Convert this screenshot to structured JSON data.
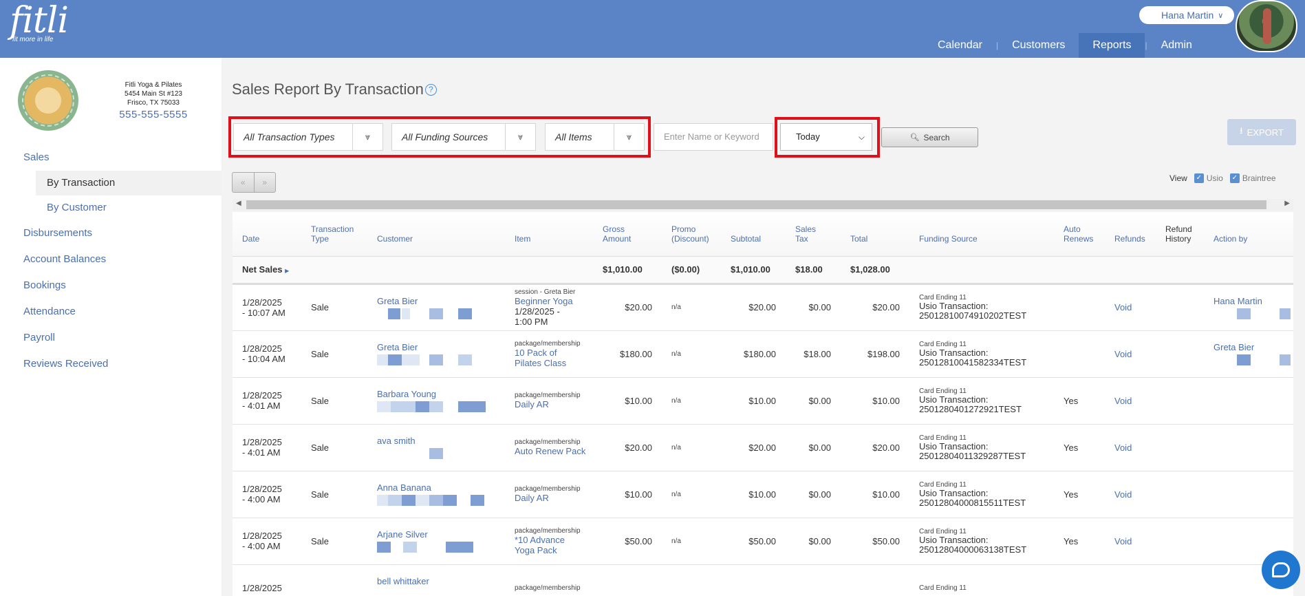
{
  "brand": {
    "name": "fitli",
    "tagline": "fit more in life"
  },
  "user": {
    "name": "Hana Martin"
  },
  "nav": [
    "Calendar",
    "Customers",
    "Reports",
    "Admin"
  ],
  "studio": {
    "name": "Fitli Yoga & Pilates",
    "address1": "5454 Main St #123",
    "address2": "Frisco, TX 75033",
    "phone": "555-555-5555"
  },
  "sidebar": {
    "sales": "Sales",
    "sub": [
      "By Transaction",
      "By Customer"
    ],
    "items": [
      "Disbursements",
      "Account Balances",
      "Bookings",
      "Attendance",
      "Payroll",
      "Reviews Received"
    ]
  },
  "page": {
    "title": "Sales Report By Transaction",
    "help": "?"
  },
  "filters": {
    "transaction_types": "All Transaction Types",
    "funding_sources": "All Funding Sources",
    "items": "All Items",
    "keyword_placeholder": "Enter Name or Keyword",
    "date": "Today",
    "search": "Search",
    "export": "EXPORT"
  },
  "pager": {
    "prev": "«",
    "next": "»"
  },
  "view": {
    "label": "View",
    "opt1": "Usio",
    "opt2": "Braintree"
  },
  "columns": {
    "date": "Date",
    "type1": "Transaction",
    "type2": "Type",
    "customer": "Customer",
    "item": "Item",
    "gross1": "Gross",
    "gross2": "Amount",
    "promo1": "Promo",
    "promo2": "(Discount)",
    "subtotal": "Subtotal",
    "tax1": "Sales",
    "tax2": "Tax",
    "total": "Total",
    "funding": "Funding Source",
    "auto1": "Auto",
    "auto2": "Renews",
    "refunds": "Refunds",
    "rh1": "Refund",
    "rh2": "History",
    "action": "Action by"
  },
  "net_sales": {
    "label": "Net Sales",
    "gross": "$1,010.00",
    "promo": "($0.00)",
    "subtotal": "$1,010.00",
    "tax": "$18.00",
    "total": "$1,028.00"
  },
  "rows": [
    {
      "date1": "1/28/2025",
      "date2": "- 10:07 AM",
      "type": "Sale",
      "customer": "Greta Bier",
      "item_cat": "session - Greta Bier",
      "item1": "Beginner Yoga",
      "item2": "1/28/2025 -",
      "item3": "1:00 PM",
      "gross": "$20.00",
      "promo": "n/a",
      "subtotal": "$20.00",
      "tax": "$0.00",
      "total": "$20.00",
      "card": "Card Ending 11",
      "usio": "Usio Transaction:",
      "txn": "25012810074910202TEST",
      "auto": "",
      "refund": "Void",
      "action": "Hana Martin"
    },
    {
      "date1": "1/28/2025",
      "date2": "- 10:04 AM",
      "type": "Sale",
      "customer": "Greta Bier",
      "item_cat": "package/membership",
      "item1": "10 Pack of",
      "item2": "Pilates Class",
      "item3": "",
      "gross": "$180.00",
      "promo": "n/a",
      "subtotal": "$180.00",
      "tax": "$18.00",
      "total": "$198.00",
      "card": "Card Ending 11",
      "usio": "Usio Transaction:",
      "txn": "25012810041582334TEST",
      "auto": "",
      "refund": "Void",
      "action": "Greta Bier"
    },
    {
      "date1": "1/28/2025",
      "date2": "- 4:01 AM",
      "type": "Sale",
      "customer": "Barbara Young",
      "item_cat": "package/membership",
      "item1": "Daily AR",
      "item2": "",
      "item3": "",
      "gross": "$10.00",
      "promo": "n/a",
      "subtotal": "$10.00",
      "tax": "$0.00",
      "total": "$10.00",
      "card": "Card Ending 11",
      "usio": "Usio Transaction:",
      "txn": "25012804012729​21TEST",
      "auto": "Yes",
      "refund": "Void",
      "action": ""
    },
    {
      "date1": "1/28/2025",
      "date2": "- 4:01 AM",
      "type": "Sale",
      "customer": "ava smith",
      "item_cat": "package/membership",
      "item1": "Auto Renew Pack",
      "item2": "",
      "item3": "",
      "gross": "$20.00",
      "promo": "n/a",
      "subtotal": "$20.00",
      "tax": "$0.00",
      "total": "$20.00",
      "card": "Card Ending 11",
      "usio": "Usio Transaction:",
      "txn": "25012804011329287TEST",
      "auto": "Yes",
      "refund": "Void",
      "action": ""
    },
    {
      "date1": "1/28/2025",
      "date2": "- 4:00 AM",
      "type": "Sale",
      "customer": "Anna Banana",
      "item_cat": "package/membership",
      "item1": "Daily AR",
      "item2": "",
      "item3": "",
      "gross": "$10.00",
      "promo": "n/a",
      "subtotal": "$10.00",
      "tax": "$0.00",
      "total": "$10.00",
      "card": "Card Ending 11",
      "usio": "Usio Transaction:",
      "txn": "25012804000815511TEST",
      "auto": "Yes",
      "refund": "Void",
      "action": ""
    },
    {
      "date1": "1/28/2025",
      "date2": "- 4:00 AM",
      "type": "Sale",
      "customer": "Arjane Silver",
      "item_cat": "package/membership",
      "item1": "*10 Advance",
      "item2": "Yoga Pack",
      "item3": "",
      "gross": "$50.00",
      "promo": "n/a",
      "subtotal": "$50.00",
      "tax": "$0.00",
      "total": "$50.00",
      "card": "Card Ending 11",
      "usio": "Usio Transaction:",
      "txn": "25012804000063138TEST",
      "auto": "Yes",
      "refund": "Void",
      "action": ""
    },
    {
      "date1": "1/28/2025",
      "date2": "",
      "type": "",
      "customer": "bell whittaker",
      "item_cat": "package/membership",
      "item1": "",
      "item2": "",
      "item3": "",
      "gross": "",
      "promo": "",
      "subtotal": "",
      "tax": "",
      "total": "",
      "card": "Card Ending 11",
      "usio": "",
      "txn": "",
      "auto": "",
      "refund": "",
      "action": ""
    }
  ],
  "colors": {
    "header": "#5a84c6",
    "highlight": "#e0101a",
    "link": "#4a6fb0"
  }
}
